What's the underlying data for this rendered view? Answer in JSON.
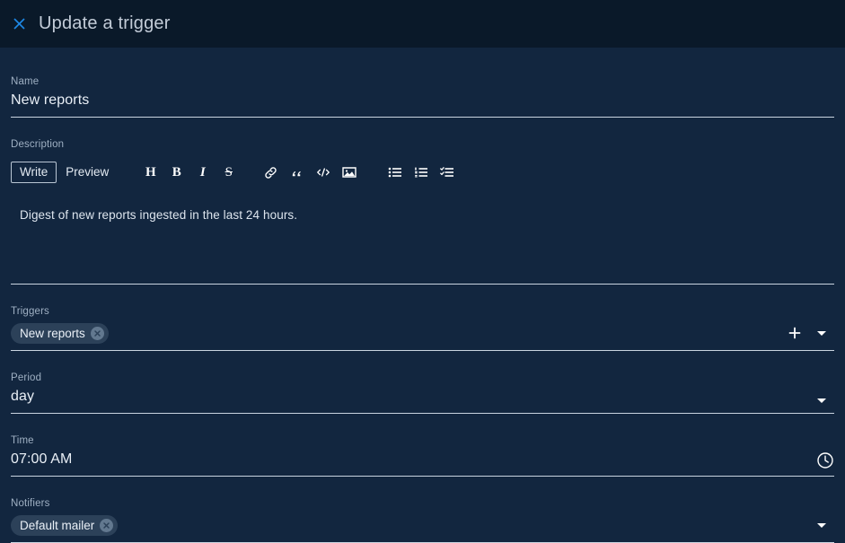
{
  "header": {
    "close_icon": "close-icon",
    "title": "Update a trigger"
  },
  "form": {
    "name": {
      "label": "Name",
      "value": "New reports"
    },
    "description": {
      "label": "Description",
      "tabs": [
        {
          "label": "Write",
          "active": true
        },
        {
          "label": "Preview",
          "active": false
        }
      ],
      "toolbar": [
        {
          "name": "heading-icon",
          "glyph": "H"
        },
        {
          "name": "bold-icon",
          "glyph": "B"
        },
        {
          "name": "italic-icon",
          "glyph": "I"
        },
        {
          "name": "strikethrough-icon",
          "glyph": "S"
        },
        {
          "name": "link-icon"
        },
        {
          "name": "quote-icon"
        },
        {
          "name": "code-icon"
        },
        {
          "name": "image-icon"
        },
        {
          "name": "bulleted-list-icon"
        },
        {
          "name": "numbered-list-icon"
        },
        {
          "name": "task-list-icon"
        }
      ],
      "text": "Digest of new reports ingested in the last 24 hours."
    },
    "triggers": {
      "label": "Triggers",
      "chips": [
        "New reports"
      ],
      "add_icon": "plus-icon",
      "dropdown_icon": "chevron-down-icon"
    },
    "period": {
      "label": "Period",
      "value": "day",
      "dropdown_icon": "chevron-down-icon"
    },
    "time": {
      "label": "Time",
      "value": "07:00 AM",
      "icon": "clock-icon"
    },
    "notifiers": {
      "label": "Notifiers",
      "chips": [
        "Default mailer"
      ],
      "dropdown_icon": "chevron-down-icon"
    }
  },
  "colors": {
    "header_bg": "#0a1929",
    "body_bg": "#12263f",
    "accent": "#1e88e5",
    "underline": "#c9d4e0",
    "chip_bg": "#2c4159",
    "label": "#9fb0c3"
  }
}
